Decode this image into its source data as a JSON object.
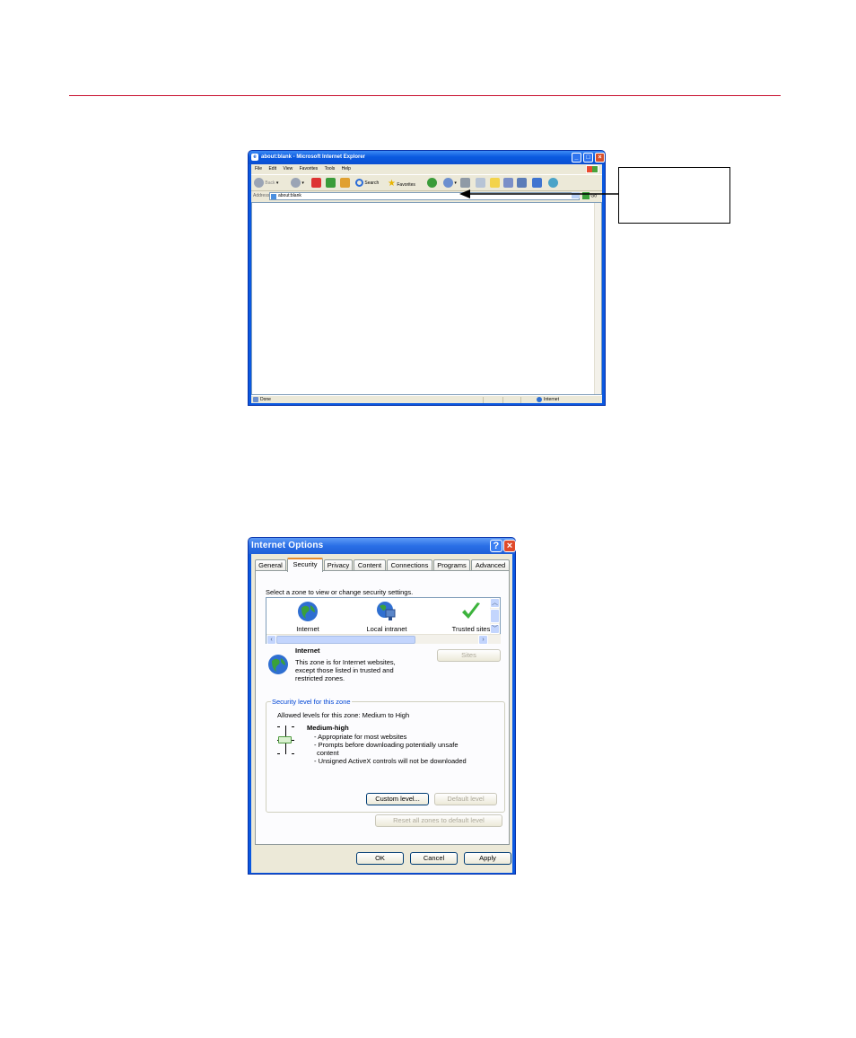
{
  "ie_window": {
    "title": "about:blank - Microsoft Internet Explorer",
    "menu": [
      "File",
      "Edit",
      "View",
      "Favorites",
      "Tools",
      "Help"
    ],
    "toolbar": {
      "back": "Back",
      "search": "Search",
      "favorites": "Favorites"
    },
    "address_label": "Address",
    "address_value": "about:blank",
    "go_label": "Go",
    "status_left": "Done",
    "status_zone": "Internet"
  },
  "options_dialog": {
    "title": "Internet Options",
    "tabs": [
      "General",
      "Security",
      "Privacy",
      "Content",
      "Connections",
      "Programs",
      "Advanced"
    ],
    "active_tab": "Security",
    "select_zone_text": "Select a zone to view or change security settings.",
    "zones": [
      "Internet",
      "Local intranet",
      "Trusted sites"
    ],
    "selected_zone": {
      "name": "Internet",
      "description": [
        "This zone is for Internet websites,",
        "except those listed in trusted and",
        "restricted zones."
      ]
    },
    "sites_button": "Sites",
    "security_group_label": "Security level for this zone",
    "allowed_levels": "Allowed levels for this zone: Medium to High",
    "level_name": "Medium-high",
    "level_bullets": [
      "- Appropriate for most websites",
      "- Prompts before downloading potentially unsafe",
      "content",
      "- Unsigned ActiveX controls will not be downloaded"
    ],
    "custom_level_button": "Custom level...",
    "default_level_button": "Default level",
    "reset_button": "Reset all zones to default level",
    "ok_button": "OK",
    "cancel_button": "Cancel",
    "apply_button": "Apply"
  },
  "colors": {
    "rule": "#c8102e",
    "xp_blue": "#0a58e0",
    "dialog_face": "#ece9d8"
  }
}
